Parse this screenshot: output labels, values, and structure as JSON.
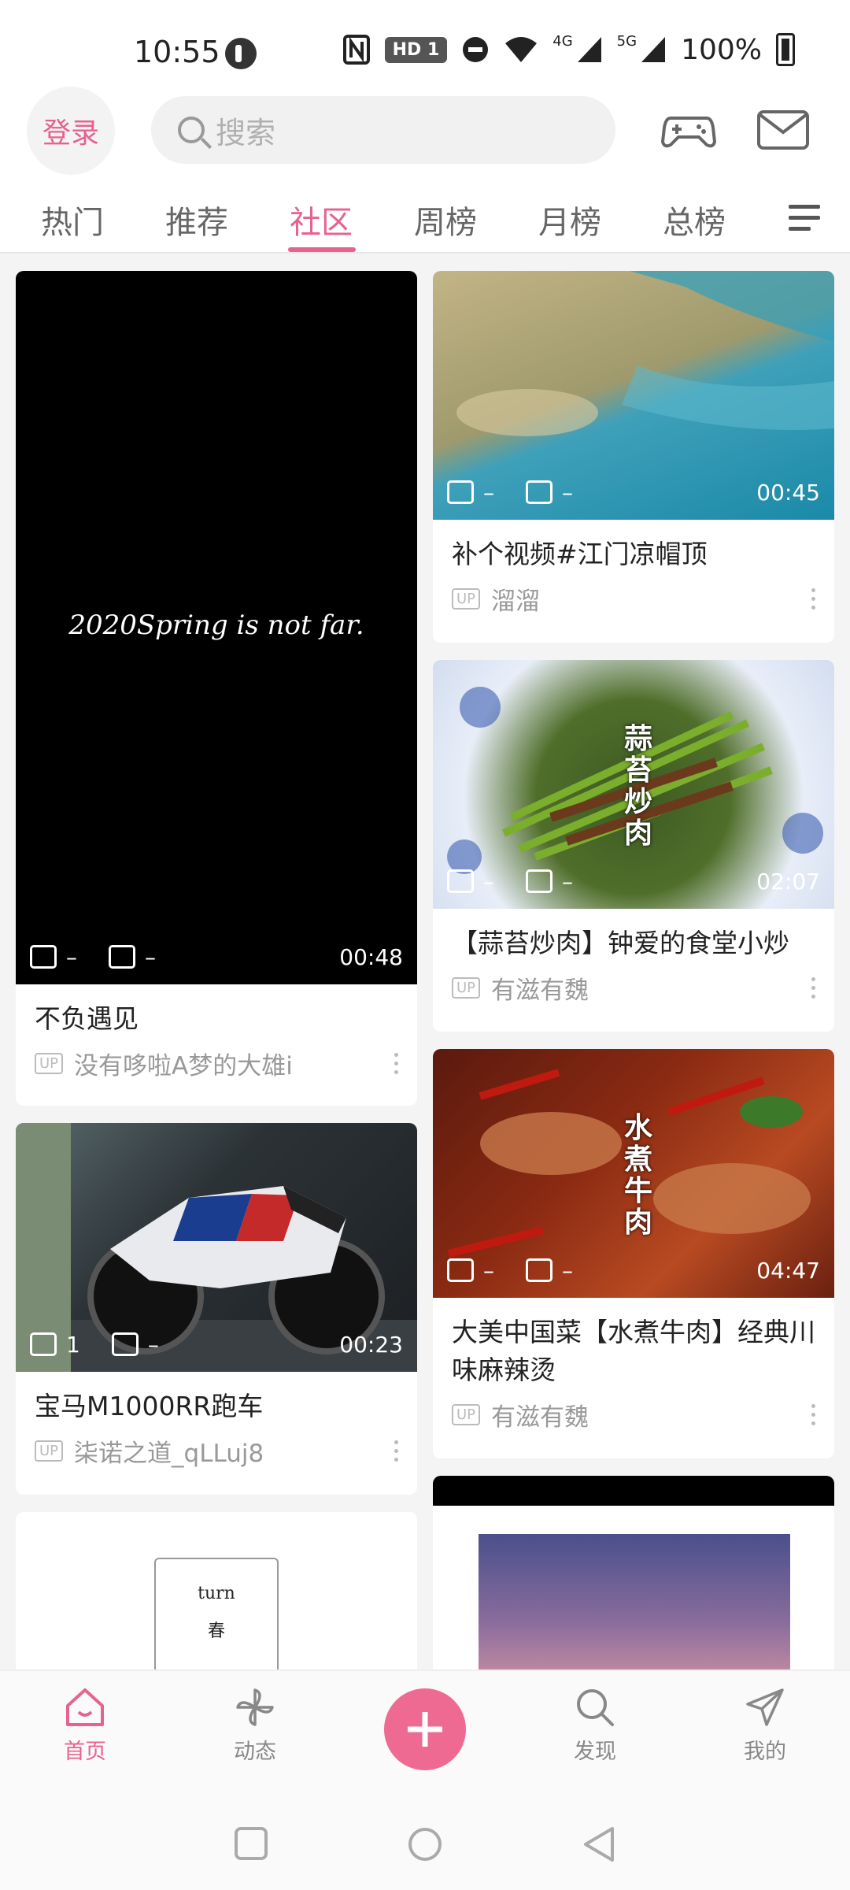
{
  "status_bar": {
    "time": "10:55",
    "hd_badge": "HD 1",
    "net1": "4G",
    "net2": "5G",
    "battery": "100%"
  },
  "header": {
    "login_label": "登录",
    "search_placeholder": "搜索",
    "game_icon": "gamepad-icon",
    "mail_icon": "mail-icon"
  },
  "tabs": {
    "items": [
      {
        "label": "热门"
      },
      {
        "label": "推荐"
      },
      {
        "label": "社区"
      },
      {
        "label": "周榜"
      },
      {
        "label": "月榜"
      },
      {
        "label": "总榜"
      }
    ],
    "active_index": 2
  },
  "feed": {
    "cards": [
      {
        "title": "不负遇见",
        "author": "没有哆啦A梦的大雄i",
        "share": "–",
        "comments": "–",
        "duration": "00:48",
        "thumb_text": "2020Spring is not far."
      },
      {
        "title": "宝马M1000RR跑车",
        "author": "柒诺之道_qLLuj8",
        "share": "1",
        "comments": "–",
        "duration": "00:23"
      },
      {
        "title": "",
        "author": "",
        "thumb_text": "turn\n春"
      },
      {
        "title": "补个视频#江门凉帽顶",
        "author": "溜溜",
        "share": "–",
        "comments": "–",
        "duration": "00:45"
      },
      {
        "title": "【蒜苔炒肉】钟爱的食堂小炒",
        "author": "有滋有魏",
        "share": "–",
        "comments": "–",
        "duration": "02:07",
        "thumb_text": "蒜苔炒肉"
      },
      {
        "title": "大美中国菜【水煮牛肉】经典川味麻辣烫",
        "author": "有滋有魏",
        "share": "–",
        "comments": "–",
        "duration": "04:47",
        "thumb_text": "水煮牛肉"
      },
      {
        "title": "",
        "author": ""
      }
    ],
    "up_badge": "UP"
  },
  "bottom_nav": {
    "items": [
      {
        "label": "首页",
        "icon": "home-icon"
      },
      {
        "label": "动态",
        "icon": "pinwheel-icon"
      },
      {
        "label": "发现",
        "icon": "search-icon"
      },
      {
        "label": "我的",
        "icon": "paper-plane-icon"
      }
    ],
    "active_index": 0,
    "fab_icon": "plus-icon"
  },
  "colors": {
    "accent": "#e6628f",
    "fab": "#ee6a93"
  }
}
